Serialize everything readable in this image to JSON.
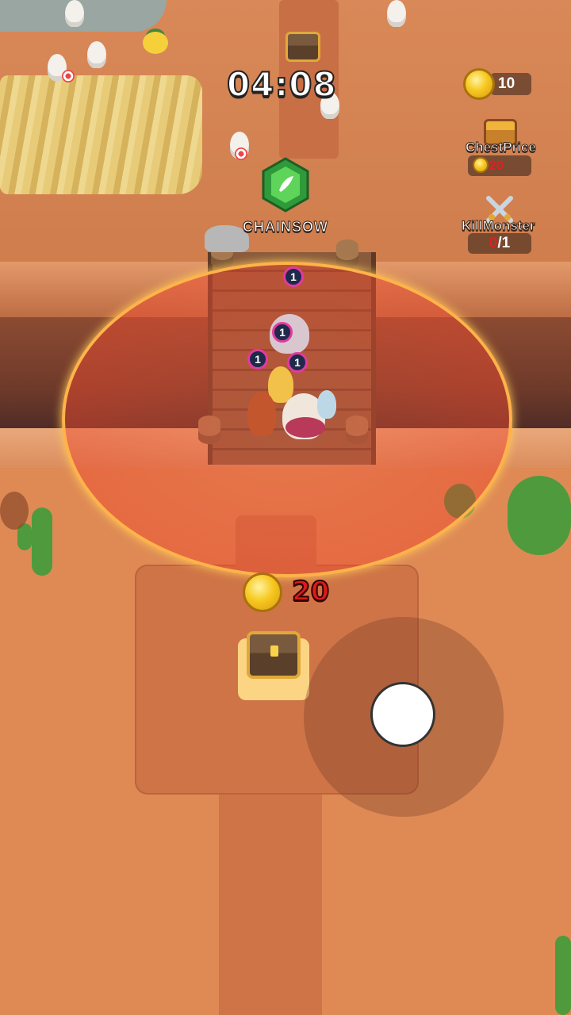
{
  "hud": {
    "timer": "04:08",
    "coins": "10",
    "chest_price": {
      "label": "ChestPrice",
      "value": "20"
    },
    "kill_monster": {
      "label": "KillMonster",
      "current": "0",
      "total": "/1"
    }
  },
  "powerup": {
    "name": "CHAINSOW"
  },
  "chest": {
    "price": "20"
  },
  "units": {
    "levels": [
      "1",
      "1",
      "1",
      "1"
    ]
  },
  "colors": {
    "ground": "#df8a55",
    "path": "#cf7447",
    "range_ring": "#ffb34a",
    "price_red": "#d81c1c",
    "gem_green": "#3fbf4a"
  },
  "icons": [
    "coin-icon",
    "chest-icon",
    "crossed-swords-icon",
    "gem-icon",
    "joystick-knob"
  ]
}
